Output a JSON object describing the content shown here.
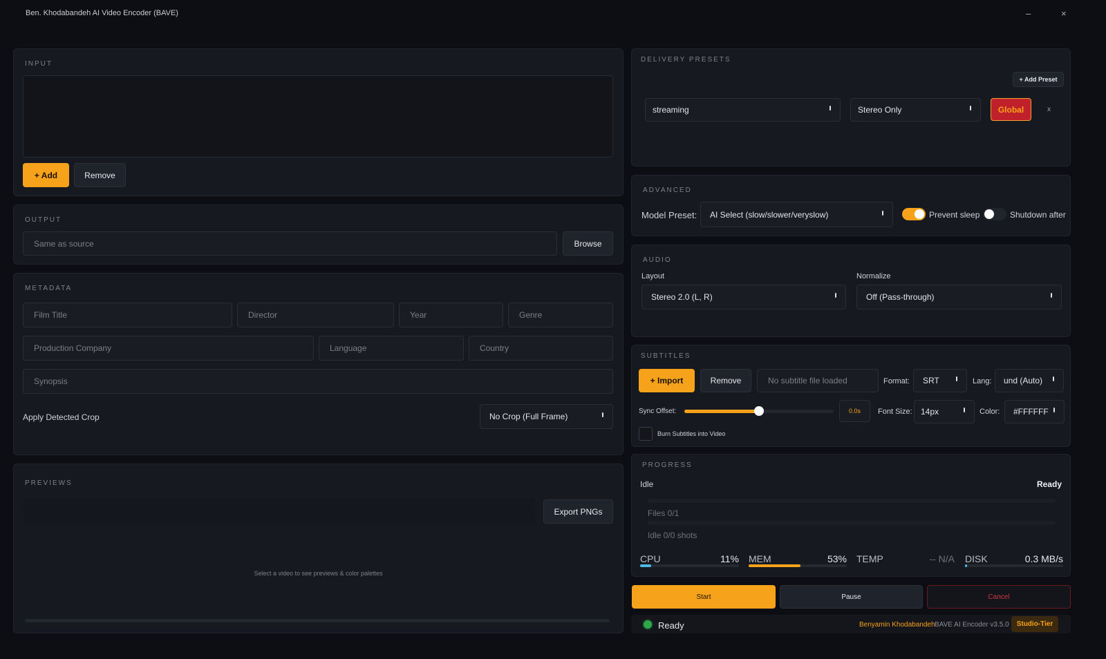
{
  "window": {
    "title": "Ben. Khodabandeh AI Video Encoder (BAVE)",
    "minimize": "–",
    "close": "×"
  },
  "input": {
    "heading": "INPUT",
    "add_label": "+ Add",
    "remove_label": "Remove"
  },
  "output": {
    "heading": "OUTPUT",
    "path_placeholder": "Same as source",
    "browse_label": "Browse"
  },
  "metadata": {
    "heading": "METADATA",
    "film_title": "Film Title",
    "director": "Director",
    "year": "Year",
    "genre": "Genre",
    "production_company": "Production Company",
    "language": "Language",
    "country": "Country",
    "synopsis": "Synopsis",
    "crop_label": "Apply Detected Crop",
    "crop_value": "No Crop (Full Frame)"
  },
  "previews": {
    "heading": "PREVIEWS",
    "export_label": "Export PNGs",
    "empty_text": "Select a video to see previews & color palettes"
  },
  "delivery": {
    "heading": "DELIVERY PRESETS",
    "add_preset": "+ Add Preset",
    "preset_value": "streaming",
    "audio_value": "Stereo Only",
    "global_label": "Global",
    "remove_x": "x"
  },
  "advanced": {
    "heading": "ADVANCED",
    "model_label": "Model Preset:",
    "model_value": "AI Select (slow/slower/veryslow)",
    "prevent_sleep": "Prevent sleep",
    "prevent_sleep_on": true,
    "shutdown_after": "Shutdown after",
    "shutdown_on": false
  },
  "audio": {
    "heading": "AUDIO",
    "layout_label": "Layout",
    "layout_value": "Stereo 2.0 (L, R)",
    "normalize_label": "Normalize",
    "normalize_value": "Off (Pass-through)"
  },
  "subtitles": {
    "heading": "SUBTITLES",
    "import_label": "+ Import",
    "remove_label": "Remove",
    "file_status": "No subtitle file loaded",
    "format_label": "Format:",
    "format_value": "SRT",
    "lang_label": "Lang:",
    "lang_value": "und (Auto)",
    "sync_label": "Sync Offset:",
    "sync_value": "0.0s",
    "sync_fraction": 0.5,
    "font_size_label": "Font Size:",
    "font_size_value": "14px",
    "color_label": "Color:",
    "color_value": "#FFFFFF",
    "burn_label": "Burn Subtitles into Video"
  },
  "progress": {
    "heading": "PROGRESS",
    "status_left": "Idle",
    "status_right": "Ready",
    "files_label": "Files  0/1",
    "shots_label": "Idle  0/0 shots",
    "cpu_label": "CPU",
    "cpu_value": "11%",
    "cpu_fraction": 0.11,
    "mem_label": "MEM",
    "mem_value": "53%",
    "mem_fraction": 0.53,
    "temp_label": "TEMP",
    "temp_value": "-- N/A",
    "disk_label": "DISK",
    "disk_value": "0.3 MB/s",
    "disk_fraction": 0.02
  },
  "actions": {
    "start": "Start",
    "pause": "Pause",
    "cancel": "Cancel"
  },
  "statusbar": {
    "status": "Ready",
    "author": "Benyamin Khodabandeh",
    "version": "BAVE AI Encoder v3.5.0",
    "tier": "Studio-Tier"
  },
  "colors": {
    "accent": "#f7a21b",
    "danger": "#c0202a",
    "cpu_bar": "#4fb8e6",
    "status_dot": "#2ea84a"
  }
}
